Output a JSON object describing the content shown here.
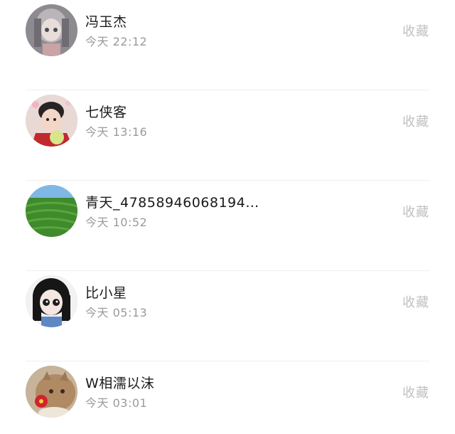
{
  "items": [
    {
      "name": "冯玉杰",
      "time": "今天 22:12",
      "action": "收藏",
      "avatar": "avatar-anime-girl-icon"
    },
    {
      "name": "七侠客",
      "time": "今天 13:16",
      "action": "收藏",
      "avatar": "avatar-boy-portrait-icon"
    },
    {
      "name": "青天_47858946068194…",
      "time": "今天 10:52",
      "action": "收藏",
      "avatar": "avatar-green-field-icon"
    },
    {
      "name": "比小星",
      "time": "今天 05:13",
      "action": "收藏",
      "avatar": "avatar-cartoon-girl-icon"
    },
    {
      "name": "W相濡以沫",
      "time": "今天 03:01",
      "action": "收藏",
      "avatar": "avatar-cat-flower-icon"
    }
  ]
}
